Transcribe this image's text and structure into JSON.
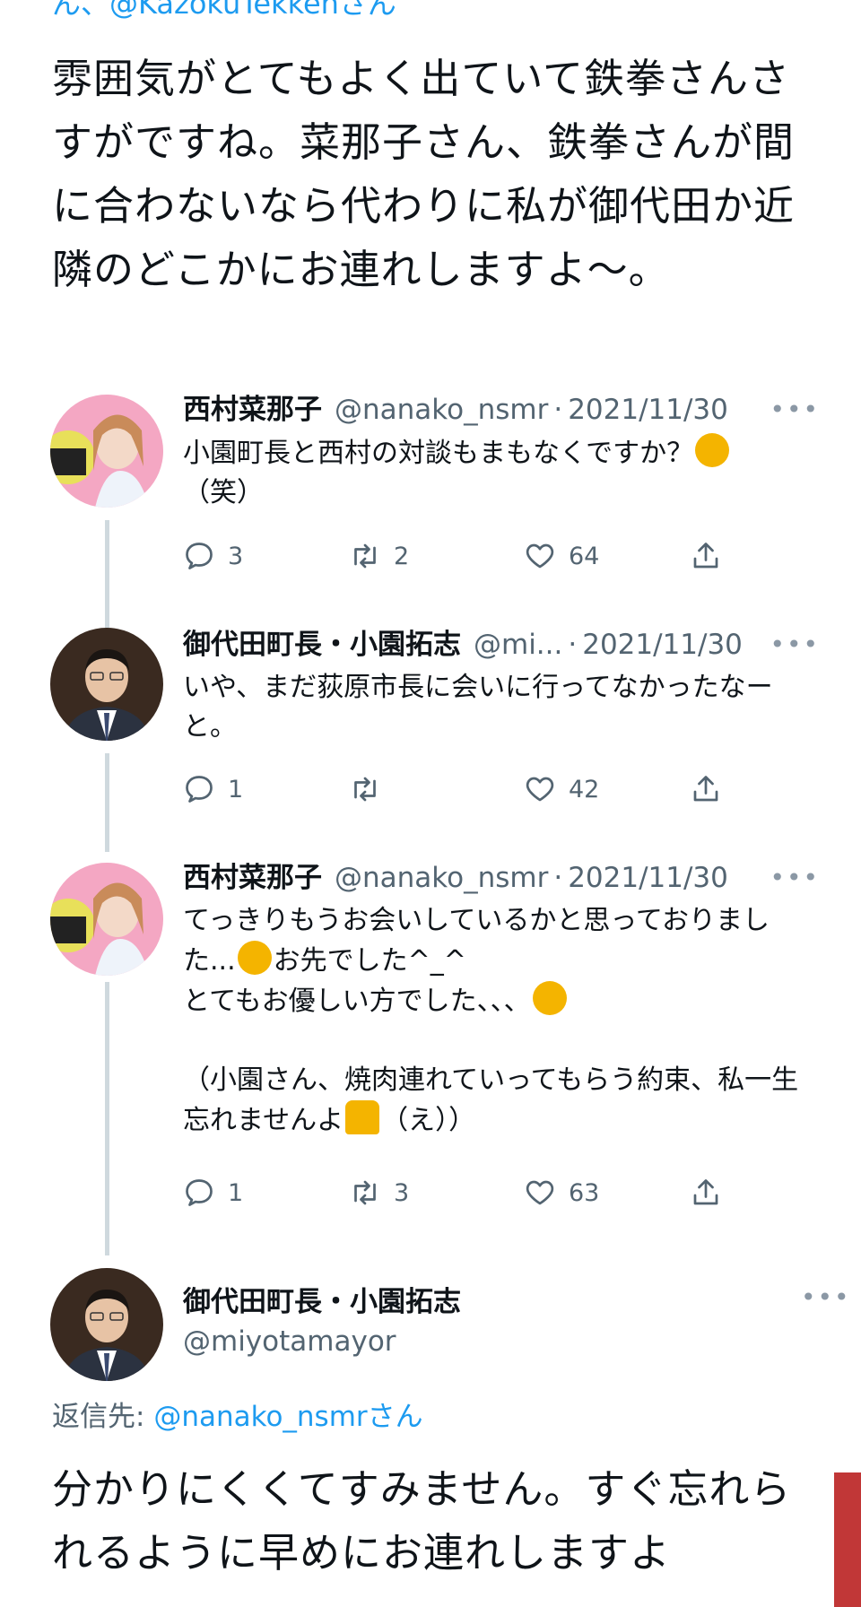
{
  "top_mention": "ん、@KazokuTekkenさん",
  "main_tweet": {
    "text": "雰囲気がとてもよく出ていて鉄拳さんさすがですね。菜那子さん、鉄拳さんが間に合わないなら代わりに私が御代田か近隣のどこかにお連れしますよ～。"
  },
  "replies": [
    {
      "name": "西村菜那子",
      "handle": "@nanako_nsmr",
      "separator": "·",
      "date": "2021/11/30",
      "text_before_emoji": "小園町長と西村の対談もまもなくですか？",
      "emoji": "thinking-face",
      "text_after_emoji": "（笑）",
      "reply_count": "3",
      "retweet_count": "2",
      "like_count": "64"
    },
    {
      "name": "御代田町長・小園拓志",
      "handle": "@mi...",
      "separator": "·",
      "date": "2021/11/30",
      "text": "いや、まだ荻原市長に会いに行ってなかったなーと。",
      "reply_count": "1",
      "retweet_count": "",
      "like_count": "42"
    },
    {
      "name": "西村菜那子",
      "handle": "@nanako_nsmr",
      "separator": "·",
      "date": "2021/11/30",
      "text_line1": "てっきりもうお会いしているかと思っておりました...",
      "emoji1": "pleading-face",
      "text_line1b": "お先でした^_^",
      "text_line2": "とてもお優しい方でした、、、",
      "emoji2": "loudly-crying-face",
      "text_line3": "（小園さん、焼肉連れていってもらう約束、私一生忘れませんよ",
      "emoji3": "raising-hands",
      "text_line3b": "（え））",
      "reply_count": "1",
      "retweet_count": "3",
      "like_count": "63"
    }
  ],
  "main_author": {
    "name": "御代田町長・小園拓志",
    "handle": "@miyotamayor"
  },
  "replying_to": {
    "label": "返信先:",
    "handle": "@nanako_nsmr",
    "suffix": "さん"
  },
  "final_tweet": {
    "text": "分かりにくくてすみません。すぐ忘れられるように早めにお連れしますよ"
  },
  "more_label": "•••",
  "colors": {
    "link": "#1d9bf0",
    "secondary_text": "#536471",
    "thread_line": "#cfd9de",
    "scroll_thumb": "#c13737"
  }
}
